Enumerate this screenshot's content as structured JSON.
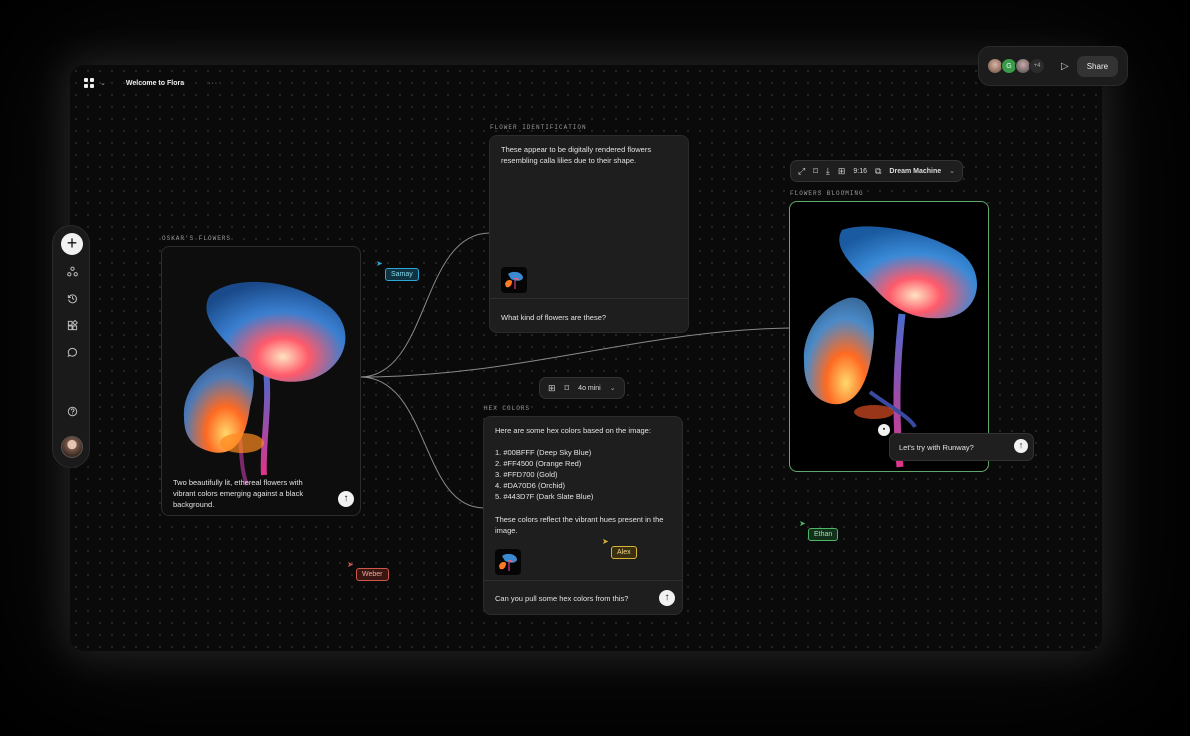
{
  "app": {
    "board_title": "Welcome to Flora",
    "more_label": "···"
  },
  "share_bar": {
    "avatars": [
      {
        "name": "user-1",
        "initial": ""
      },
      {
        "name": "user-2",
        "initial": "G"
      },
      {
        "name": "user-3",
        "initial": ""
      }
    ],
    "extra_count": "+4",
    "share_label": "Share"
  },
  "sidebar": {
    "items": [
      {
        "icon": "plus-icon"
      },
      {
        "icon": "nodes-icon"
      },
      {
        "icon": "history-icon"
      },
      {
        "icon": "widgets-icon"
      },
      {
        "icon": "comment-icon"
      },
      {
        "icon": "help-icon"
      }
    ]
  },
  "nodes": {
    "oskars_flowers": {
      "label": "OSKAR'S FLOWERS",
      "caption": "Two beautifully lit, ethereal flowers with vibrant colors emerging against a black background."
    },
    "flower_identification": {
      "label": "FLOWER IDENTIFICATION",
      "response": "These appear to be digitally rendered flowers resembling calla lilies due to their shape.",
      "prompt": "What kind of flowers are these?"
    },
    "hex_colors": {
      "label": "HEX COLORS",
      "intro": "Here are some hex colors based on the image:",
      "colors": [
        "1. #00BFFF (Deep Sky Blue)",
        "2. #FF4500 (Orange Red)",
        "3. #FFD700 (Gold)",
        "4. #DA70D6 (Orchid)",
        "5. #443D7F (Dark Slate Blue)"
      ],
      "outro": "These colors reflect the vibrant hues present in the image.",
      "prompt": "Can you pull some hex colors from this?"
    },
    "flowers_blooming": {
      "label": "FLOWERS BLOOMING",
      "comment_input": "Let's try with Runway?"
    }
  },
  "model_toolbar": {
    "model": "4o mini"
  },
  "video_toolbar": {
    "ratio": "9:16",
    "model": "Dream Machine"
  },
  "cursors": [
    {
      "name": "Samay",
      "color": "#2aa7d6"
    },
    {
      "name": "Weber",
      "color": "#d0584a"
    },
    {
      "name": "Alex",
      "color": "#d8b23a"
    },
    {
      "name": "Ethan",
      "color": "#4cb866"
    }
  ]
}
